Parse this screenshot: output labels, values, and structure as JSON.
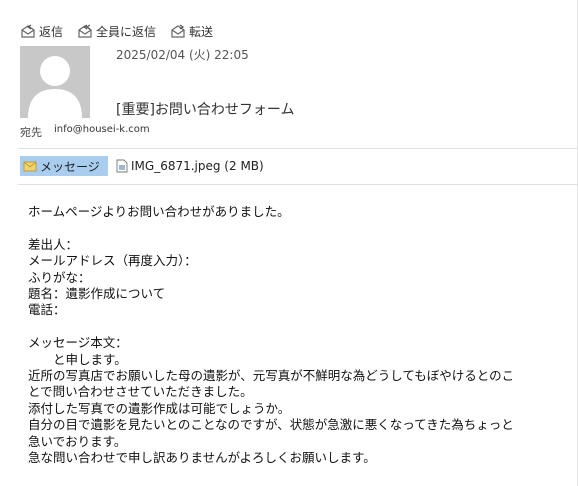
{
  "toolbar": {
    "reply_label": "返信",
    "reply_all_label": "全員に返信",
    "forward_label": "転送"
  },
  "header": {
    "date": "2025/02/04 (火) 22:05",
    "subject": "[重要]お問い合わせフォーム",
    "to_label": "宛先",
    "to_address": "info@housei-k.com"
  },
  "attachments": {
    "message_tab": "メッセージ",
    "file_label": "IMG_6871.jpeg (2 MB)"
  },
  "body": {
    "lines": [
      "ホームページよりお問い合わせがありました。",
      "",
      "差出人：",
      "メールアドレス（再度入力）：",
      "ふりがな：",
      "題名：遺影作成について",
      "電話：",
      "",
      "メッセージ本文：",
      "　　と申します。",
      "近所の写真店でお願いした母の遺影が、元写真が不鮮明な為どうしてもぼやけるとのこ",
      "とで問い合わせさせていただきました。",
      "添付した写真での遺影作成は可能でしょうか。",
      "自分の目で遺影を見たいとのことなのですが、状態が急激に悪くなってきた為ちょっと",
      "急いでおります。",
      "急な問い合わせで申し訳ありませんがよろしくお願いします。"
    ]
  },
  "icons": {
    "reply": "envelope-reply-icon",
    "reply_all": "envelope-reply-all-icon",
    "forward": "envelope-forward-icon",
    "avatar": "person-silhouette-icon",
    "message": "envelope-icon",
    "attachment": "image-file-icon"
  }
}
